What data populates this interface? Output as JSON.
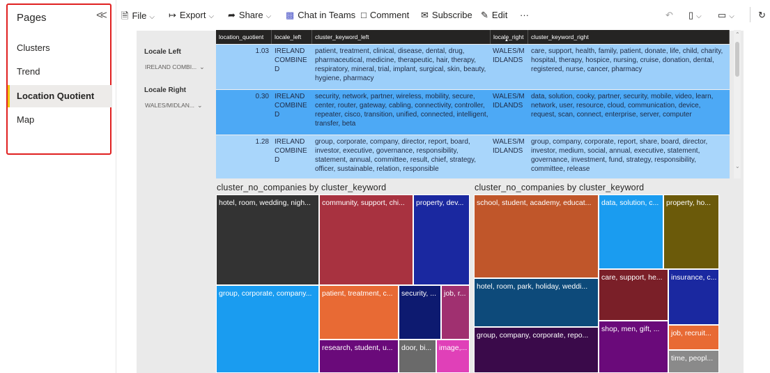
{
  "sidebar": {
    "title": "Pages",
    "items": [
      {
        "label": "Clusters"
      },
      {
        "label": "Trend"
      },
      {
        "label": "Location Quotient"
      },
      {
        "label": "Map"
      }
    ]
  },
  "toolbar": {
    "file": "File",
    "export": "Export",
    "share": "Share",
    "teams": "Chat in Teams",
    "comment": "Comment",
    "subscribe": "Subscribe",
    "edit": "Edit",
    "more": "···"
  },
  "slicers": {
    "left": {
      "label": "Locale Left",
      "value": "IRELAND COMBI..."
    },
    "right": {
      "label": "Locale Right",
      "value": "WALES/MIDLAN..."
    }
  },
  "table": {
    "headers": [
      "location_quotient",
      "locale_left",
      "cluster_keyword_left",
      "locale_right",
      "cluster_keyword_right"
    ],
    "rows": [
      {
        "quotient": "1.03",
        "locale_left": "IRELAND COMBINE D",
        "keyword_left": "patient, treatment, clinical, disease, dental, drug, pharmaceutical, medicine, therapeutic, hair, therapy, respiratory, mineral, trial, implant, surgical, skin, beauty, hygiene, pharmacy",
        "locale_right": "WALES/M IDLANDS",
        "keyword_right": "care, support, health, family, patient, donate, life, child, charity, hospital, therapy, hospice, nursing, cruise, donation, dental, registered, nurse, cancer, pharmacy"
      },
      {
        "quotient": "0.30",
        "locale_left": "IRELAND COMBINE D",
        "keyword_left": "security, network, partner, wireless, mobility, secure, center, router, gateway, cabling, connectivity, controller, repeater, cisco, transition, unified, connected, intelligent, transfer, beta",
        "locale_right": "WALES/M IDLANDS",
        "keyword_right": "data, solution, cooky, partner, security, mobile, video, learn, network, user, resource, cloud, communication, device, request, scan, connect, enterprise, server, computer"
      },
      {
        "quotient": "1.28",
        "locale_left": "IRELAND COMBINE D",
        "keyword_left": "group, corporate, company, director, report, board, investor, executive, governance, responsibility, statement, annual, committee, result, chief, strategy, officer, sustainable, relation, responsible",
        "locale_right": "WALES/M IDLANDS",
        "keyword_right": "group, company, corporate, report, share, board, director, investor, medium, social, annual, executive, statement, governance, investment, fund, strategy, responsibility, committee, release"
      }
    ]
  },
  "treemaps": {
    "left": {
      "title": "cluster_no_companies by cluster_keyword",
      "tiles": [
        {
          "label": "hotel, room, wedding, nigh...",
          "color": "#333333"
        },
        {
          "label": "community, support, chi...",
          "color": "#a83240"
        },
        {
          "label": "property, dev...",
          "color": "#1a28a0"
        },
        {
          "label": "group, corporate, company...",
          "color": "#1a9cf0"
        },
        {
          "label": "patient, treatment, c...",
          "color": "#e86a34"
        },
        {
          "label": "security, ...",
          "color": "#0d1a70"
        },
        {
          "label": "job, r...",
          "color": "#a03070"
        },
        {
          "label": "research, student, u...",
          "color": "#6a0a7a"
        },
        {
          "label": "door, bi...",
          "color": "#6a6a6a"
        },
        {
          "label": "image,...",
          "color": "#e040b8"
        }
      ]
    },
    "right": {
      "title": "cluster_no_companies by cluster_keyword",
      "tiles": [
        {
          "label": "school, student, academy, educat...",
          "color": "#c0562a"
        },
        {
          "label": "data, solution, c...",
          "color": "#1a9cf0"
        },
        {
          "label": "property, ho...",
          "color": "#6b5a0a"
        },
        {
          "label": "hotel, room, park, holiday, weddi...",
          "color": "#0d4a7a"
        },
        {
          "label": "care, support, he...",
          "color": "#7a1f28"
        },
        {
          "label": "insurance, c...",
          "color": "#1a28a0"
        },
        {
          "label": "group, company, corporate, repo...",
          "color": "#3a0a4a"
        },
        {
          "label": "shop, men, gift, ...",
          "color": "#6a0a7a"
        },
        {
          "label": "job, recruit...",
          "color": "#e86a34"
        },
        {
          "label": "time, peopl...",
          "color": "#8a8a8a"
        }
      ]
    }
  }
}
